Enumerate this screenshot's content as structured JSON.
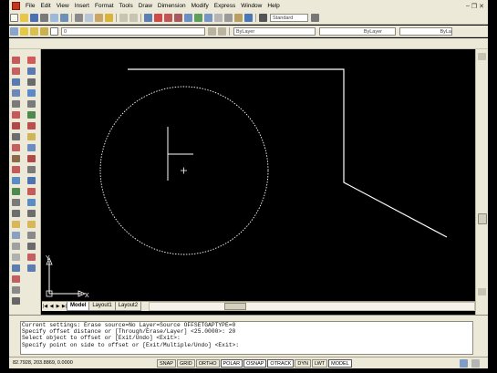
{
  "menu": {
    "items": [
      "File",
      "Edit",
      "View",
      "Insert",
      "Format",
      "Tools",
      "Draw",
      "Dimension",
      "Modify",
      "Express",
      "Window",
      "Help"
    ]
  },
  "toolbar": {
    "textstyle": "Standard",
    "layer_value": "0",
    "color_value": "ByLayer",
    "linetype_value": "ByLayer",
    "lineweight_value": "ByLa"
  },
  "tabs": [
    {
      "label": "Model",
      "active": true
    },
    {
      "label": "Layout1",
      "active": false
    },
    {
      "label": "Layout2",
      "active": false
    }
  ],
  "ucs": {
    "x_label": "X",
    "y_label": "Y"
  },
  "command": {
    "lines": [
      "Current settings: Erase source=No  Layer=Source  OFFSETGAPTYPE=0",
      "Specify offset distance or [Through/Erase/Layer] <25.0000>: 20",
      "Select object to offset or [Exit/Undo] <Exit>:",
      "Specify point on side to offset or [Exit/Multiple/Undo] <Exit>:"
    ]
  },
  "status": {
    "coords": "82.7928, 203.8869, 0.0000",
    "buttons": [
      {
        "label": "SNAP",
        "on": false
      },
      {
        "label": "GRID",
        "on": false
      },
      {
        "label": "ORTHO",
        "on": false
      },
      {
        "label": "POLAR",
        "on": true
      },
      {
        "label": "OSNAP",
        "on": true
      },
      {
        "label": "OTRACK",
        "on": true
      },
      {
        "label": "DYN",
        "on": false
      },
      {
        "label": "LWT",
        "on": false
      },
      {
        "label": "MODEL",
        "on": true
      }
    ]
  },
  "colors": {
    "canvas_bg": "#000000",
    "geometry": "#ffffff",
    "chrome": "#ece9d8",
    "app_icon": "#c8351f"
  }
}
